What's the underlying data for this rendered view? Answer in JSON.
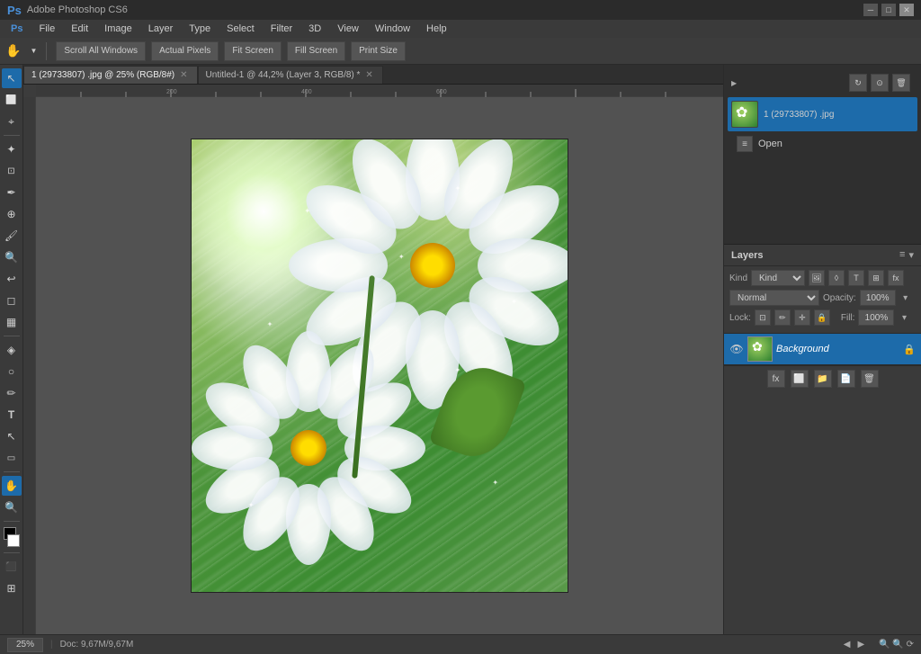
{
  "app": {
    "title": "Adobe Photoshop CS6"
  },
  "menu": {
    "items": [
      "PS",
      "File",
      "Edit",
      "Image",
      "Layer",
      "Type",
      "Select",
      "Filter",
      "3D",
      "View",
      "Window",
      "Help"
    ]
  },
  "options_bar": {
    "hand_icon": "✋",
    "buttons": [
      "Scroll All Windows",
      "Actual Pixels",
      "Fit Screen",
      "Fill Screen",
      "Print Size"
    ]
  },
  "tabs": {
    "items": [
      {
        "label": "1 (29733807) .jpg @ 25% (RGB/8#)",
        "active": true
      },
      {
        "label": "Untitled-1 @ 44,2% (Layer 3, RGB/8) *",
        "active": false
      }
    ]
  },
  "canvas": {
    "zoom": "25%",
    "doc_info": "Doc: 9,67M/9,67M"
  },
  "bridge": {
    "filename": "1 (29733807) .jpg",
    "open_label": "Open",
    "circle_icon": "○"
  },
  "layers_panel": {
    "title": "Layers",
    "kind_label": "Kind",
    "blend_mode": "Normal",
    "opacity_label": "Opacity:",
    "opacity_value": "100%",
    "fill_label": "Fill:",
    "fill_value": "100%",
    "lock_label": "Lock:",
    "background_layer": {
      "name": "Background",
      "visible": true
    }
  },
  "colors": {
    "active_tab": "#4a4a4a",
    "inactive_tab": "#3c3c3c",
    "toolbar_bg": "#3a3a3a",
    "selected_bg": "#1d6baa",
    "panel_bg": "#3a3a3a"
  }
}
